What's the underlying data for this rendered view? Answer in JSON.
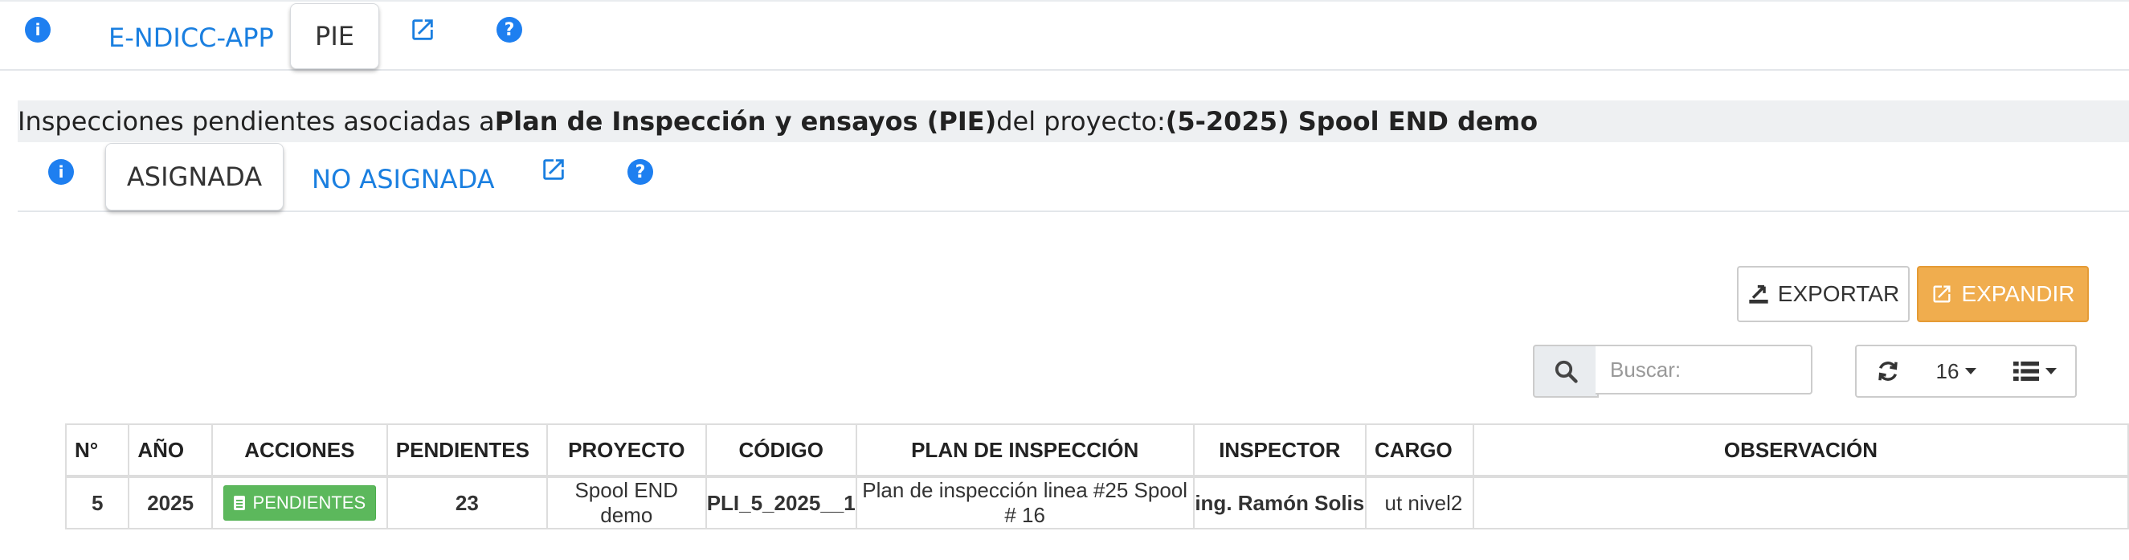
{
  "top_tabs": {
    "items": [
      {
        "label": "E-NDICC-APP",
        "active": false
      },
      {
        "label": "PIE",
        "active": true
      }
    ],
    "info_icon": "info-icon",
    "external_icon": "external-link-icon",
    "help_icon": "help-icon"
  },
  "heading": {
    "prefix": "Inspecciones pendientes asociadas a ",
    "plan": "Plan de Inspección y ensayos (PIE)",
    "middle": "del proyecto: ",
    "project": "(5-2025) Spool END demo"
  },
  "sub_tabs": {
    "items": [
      {
        "label": "ASIGNADA",
        "active": true
      },
      {
        "label": "NO ASIGNADA",
        "active": false
      }
    ]
  },
  "toolbar": {
    "export_label": "EXPORTAR",
    "expand_label": "EXPANDIR",
    "search_placeholder": "Buscar:",
    "page_size": "16",
    "colors": {
      "expand": "#f0ad4e",
      "link": "#1a7fe0",
      "success": "#5cb85c"
    }
  },
  "table": {
    "columns": [
      "N°",
      "AÑO",
      "ACCIONES",
      "PENDIENTES",
      "PROYECTO",
      "CÓDIGO",
      "PLAN DE INSPECCIÓN",
      "INSPECTOR",
      "CARGO",
      "OBSERVACIÓN"
    ],
    "rows": [
      {
        "n": "5",
        "year": "2025",
        "action": "PENDIENTES",
        "pending": "23",
        "project": "Spool END demo",
        "code": "PLI_5_2025__1",
        "plan": "Plan de inspección linea #25 Spool # 16",
        "inspector": "ing. Ramón Solis",
        "cargo": "ut nivel2",
        "obs": ""
      }
    ]
  }
}
